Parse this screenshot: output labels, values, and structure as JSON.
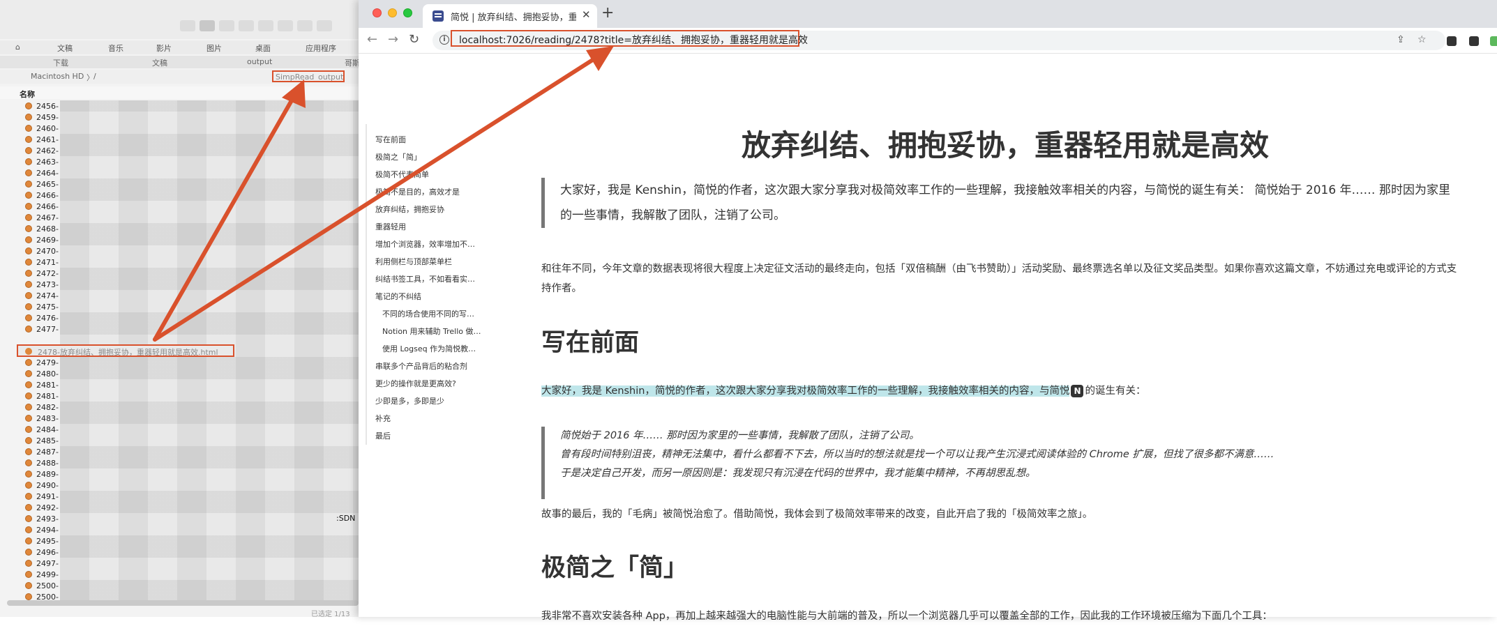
{
  "finder": {
    "favorites": [
      "文稿",
      "音乐",
      "影片",
      "图片",
      "桌面",
      "应用程序"
    ],
    "tabs": [
      "下载",
      "文稿",
      "output",
      "哥斯"
    ],
    "path": [
      "Macintosh HD",
      "/"
    ],
    "path_highlight": [
      "SimpRead",
      "output"
    ],
    "column_name": "名称",
    "files_top": [
      "2456-",
      "2459-",
      "2460-",
      "2461-",
      "2462-",
      "2463-",
      "2464-",
      "2465-",
      "2466-",
      "2466-",
      "2467-",
      "2468-",
      "2469-",
      "2470-",
      "2471-",
      "2472-",
      "2473-",
      "2474-",
      "2475-",
      "2476-",
      "2477-"
    ],
    "selected_file": "2478-放弃纠结、拥抱妥协，重器轻用就是高效.html",
    "files_bottom": [
      "2479-",
      "2480-",
      "2481-",
      "2481-",
      "2482-",
      "2483-",
      "2484-",
      "2485-",
      "2487-",
      "2488-",
      "2489-",
      "2490-",
      "2491-",
      "2492-",
      "2493-",
      "2494-",
      "2495-",
      "2496-",
      "2497-",
      "2499-",
      "2500-",
      "2500-"
    ],
    "csdn_fragment": ":SDN",
    "status": "已选定 1/13"
  },
  "browser": {
    "tab_title": "简悦 | 放弃纠结、拥抱妥协，重器",
    "url": "localhost:7026/reading/2478?title=放弃纠结、拥抱妥协，重器轻用就是高效"
  },
  "toc": [
    {
      "label": "写在前面",
      "sub": false
    },
    {
      "label": "极简之「简」",
      "sub": false
    },
    {
      "label": "极简不代表简单",
      "sub": false
    },
    {
      "label": "极简不是目的，高效才是",
      "sub": false
    },
    {
      "label": "放弃纠结，拥抱妥协",
      "sub": false
    },
    {
      "label": "重器轻用",
      "sub": false
    },
    {
      "label": "增加个浏览器，效率增加不…",
      "sub": false
    },
    {
      "label": "利用侧栏与顶部菜单栏",
      "sub": false
    },
    {
      "label": "纠结书签工具，不如看看实…",
      "sub": false
    },
    {
      "label": "笔记的不纠结",
      "sub": false
    },
    {
      "label": "不同的场合使用不同的写…",
      "sub": true
    },
    {
      "label": "Notion 用来辅助 Trello 做…",
      "sub": true
    },
    {
      "label": "使用 Logseq 作为简悦教…",
      "sub": true
    },
    {
      "label": "串联多个产品背后的粘合剂",
      "sub": false
    },
    {
      "label": "更少的操作就是更高效?",
      "sub": false
    },
    {
      "label": "少即是多，多即是少",
      "sub": false
    },
    {
      "label": "补充",
      "sub": false
    },
    {
      "label": "最后",
      "sub": false
    }
  ],
  "article": {
    "title": "放弃纠结、拥抱妥协，重器轻用就是高效",
    "quote1": "大家好，我是 Kenshin，简悦的作者，这次跟大家分享我对极简效率工作的一些理解，我接触效率相关的内容，与简悦的诞生有关： 简悦始于 2016 年…… 那时因为家里的一些事情，我解散了团队，注销了公司。",
    "notice": "和往年不同，今年文章的数据表现将很大程度上决定征文活动的最终走向，包括「双倍稿酬（由飞书赞助）」活动奖励、最终票选名单以及征文奖品类型。如果你喜欢这篇文章，不妨通过充电或评论的方式支持作者。",
    "h2_1": "写在前面",
    "intro_highlight": "大家好，我是 Kenshin，简悦的作者，这次跟大家分享我对极简效率工作的一些理解，我接触效率相关的内容，与简悦",
    "intro_badge": "N",
    "intro_rest": "的诞生有关：",
    "quote2": [
      "简悦始于 2016 年…… 那时因为家里的一些事情，我解散了团队，注销了公司。",
      "曾有段时间特别沮丧，精神无法集中，看什么都看不下去，所以当时的想法就是找一个可以让我产生沉浸式阅读体验的 Chrome 扩展，但找了很多都不满意……",
      "于是决定自己开发，而另一原因则是：我发现只有沉浸在代码的世界中，我才能集中精神，不再胡思乱想。"
    ],
    "ending": "故事的最后，我的「毛病」被简悦治愈了。借助简悦，我体会到了极简效率带来的改变，自此开启了我的「极简效率之旅」。",
    "h2_2": "极简之「简」",
    "cut_line": "我非常不喜欢安装各种 App，再加上越来越强大的电脑性能与大前端的普及，所以一个浏览器几乎可以覆盖全部的工作，因此我的工作环境被压缩为下面几个工具："
  }
}
